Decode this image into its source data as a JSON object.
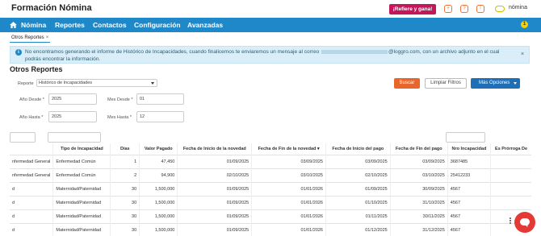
{
  "app": {
    "title": "Formación Nómina",
    "refer_button": "¡Refiere y gana!",
    "toolbar_icons": [
      "+",
      "?",
      "!"
    ],
    "user_name": "nómina"
  },
  "nav": {
    "items": [
      "Nómina",
      "Reportes",
      "Contactos",
      "Configuración",
      "Avanzadas"
    ],
    "badge": "1"
  },
  "tab": {
    "label": "Otros Reportes",
    "close": "×"
  },
  "alert": {
    "icon": "i",
    "text_before": "No encontramos generando el informe de Histórico de Incapacidades, cuando finalicemos te enviaremos un mensaje al correo",
    "text_after": "@loggro.com, con un archivo adjunto en el cual podrás encontrar la información.",
    "close": "×"
  },
  "page": {
    "title": "Otros Reportes"
  },
  "form": {
    "reporte_label": "Reporte",
    "reporte_value": "Histórico de Incapacidades",
    "anio_desde_label": "Año Desde *",
    "anio_desde_value": "2025",
    "mes_desde_label": "Mes Desde *",
    "mes_desde_value": "01",
    "anio_hasta_label": "Año Hasta *",
    "anio_hasta_value": "2025",
    "mes_hasta_label": "Mes Hasta *",
    "mes_hasta_value": "12",
    "buscar": "Buscar",
    "limpiar": "Limpiar Filtros",
    "mas_opciones": "Más Opciones"
  },
  "table": {
    "columns": [
      "",
      "Tipo de Incapacidad",
      "Días",
      "Valor Pagado",
      "Fecha de Inicio de la novedad",
      "Fecha de Fin de la novedad ▾",
      "Fecha de Inicio del pago",
      "Fecha de Fin del pago",
      "Nro Incapacidad",
      "Es Prórroga De"
    ],
    "rows": [
      [
        "nfermedad General",
        "Enfermedad Común",
        "1",
        "47,450",
        "01/09/2025",
        "03/09/2025",
        "03/09/2025",
        "03/09/2025",
        "3687485",
        ""
      ],
      [
        "nfermedad General",
        "Enfermedad Común",
        "2",
        "94,900",
        "02/10/2025",
        "03/10/2025",
        "02/10/2025",
        "03/10/2025",
        "25412233",
        ""
      ],
      [
        "d",
        "Maternidad/Paternidad",
        "30",
        "1,500,000",
        "01/09/2025",
        "01/01/2026",
        "01/09/2025",
        "30/09/2025",
        "4567",
        ""
      ],
      [
        "d",
        "Maternidad/Paternidad",
        "30",
        "1,500,000",
        "01/09/2025",
        "01/01/2026",
        "01/10/2025",
        "31/10/2025",
        "4567",
        ""
      ],
      [
        "d",
        "Maternidad/Paternidad",
        "30",
        "1,500,000",
        "01/09/2025",
        "01/01/2026",
        "01/11/2025",
        "30/11/2025",
        "4567",
        ""
      ],
      [
        "d",
        "Maternidad/Paternidad",
        "30",
        "1,500,000",
        "01/09/2025",
        "01/01/2026",
        "01/12/2025",
        "31/12/2025",
        "4567",
        ""
      ]
    ]
  },
  "colors": {
    "nav_blue": "#1e88c9",
    "refer_magenta": "#c2185b",
    "buscar_orange": "#e8662b",
    "mas_opciones_blue": "#1e6fb5",
    "chat_red": "#e53935"
  }
}
